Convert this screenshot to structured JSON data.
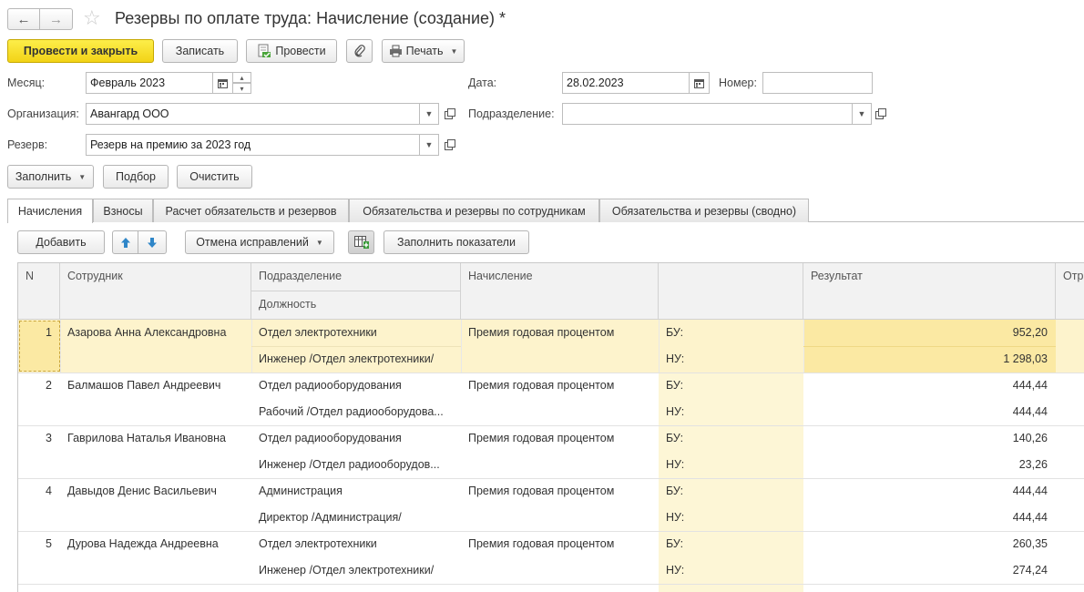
{
  "window": {
    "title": "Резервы по оплате труда: Начисление (создание) *",
    "back_icon": "←",
    "forward_icon": "→",
    "star_icon": "☆"
  },
  "toolbar": {
    "post_close": "Провести и закрыть",
    "write": "Записать",
    "post": "Провести",
    "print": "Печать"
  },
  "form": {
    "month_label": "Месяц:",
    "month_value": "Февраль 2023",
    "date_label": "Дата:",
    "date_value": "28.02.2023",
    "number_label": "Номер:",
    "number_value": "",
    "org_label": "Организация:",
    "org_value": "Авангард ООО",
    "dept_label": "Подразделение:",
    "dept_value": "",
    "reserve_label": "Резерв:",
    "reserve_value": "Резерв на премию за 2023 год"
  },
  "actions": {
    "fill": "Заполнить",
    "select": "Подбор",
    "clear": "Очистить"
  },
  "tabs": [
    {
      "label": "Начисления",
      "active": true
    },
    {
      "label": "Взносы",
      "active": false
    },
    {
      "label": "Расчет обязательств и резервов",
      "active": false
    },
    {
      "label": "Обязательства и резервы по сотрудникам",
      "active": false
    },
    {
      "label": "Обязательства и резервы (сводно)",
      "active": false
    }
  ],
  "table_toolbar": {
    "add": "Добавить",
    "undo_fixes": "Отмена исправлений",
    "fill_indicators": "Заполнить показатели"
  },
  "table": {
    "headers": {
      "n": "N",
      "employee": "Сотрудник",
      "dept": "Подразделение",
      "position": "Должность",
      "accrual": "Начисление",
      "empty": "",
      "result": "Результат",
      "next": "Отр"
    },
    "rows": [
      {
        "n": "1",
        "employee": "Азарова Анна Александровна",
        "dept": "Отдел электротехники",
        "position": "Инженер /Отдел электротехники/",
        "accrual": "Премия годовая процентом",
        "bu_label": "БУ:",
        "nu_label": "НУ:",
        "bu": "952,20",
        "nu": "1 298,03"
      },
      {
        "n": "2",
        "employee": "Балмашов Павел Андреевич",
        "dept": "Отдел радиооборудования",
        "position": "Рабочий /Отдел радиооборудова...",
        "accrual": "Премия годовая процентом",
        "bu_label": "БУ:",
        "nu_label": "НУ:",
        "bu": "444,44",
        "nu": "444,44"
      },
      {
        "n": "3",
        "employee": "Гаврилова Наталья Ивановна",
        "dept": "Отдел радиооборудования",
        "position": "Инженер /Отдел радиооборудов...",
        "accrual": "Премия годовая процентом",
        "bu_label": "БУ:",
        "nu_label": "НУ:",
        "bu": "140,26",
        "nu": "23,26"
      },
      {
        "n": "4",
        "employee": "Давыдов Денис Васильевич",
        "dept": "Администрация",
        "position": "Директор /Администрация/",
        "accrual": "Премия годовая процентом",
        "bu_label": "БУ:",
        "nu_label": "НУ:",
        "bu": "444,44",
        "nu": "444,44"
      },
      {
        "n": "5",
        "employee": "Дурова Надежда Андреевна",
        "dept": "Отдел электротехники",
        "position": "Инженер /Отдел электротехники/",
        "accrual": "Премия годовая процентом",
        "bu_label": "БУ:",
        "nu_label": "НУ:",
        "bu": "260,35",
        "nu": "274,24"
      }
    ]
  },
  "colors": {
    "primary_button": "#f4d71c",
    "selected_row": "#fdf3cc",
    "selected_cell": "#fbe9a3",
    "bu_nu_column": "#fdf6d6"
  }
}
